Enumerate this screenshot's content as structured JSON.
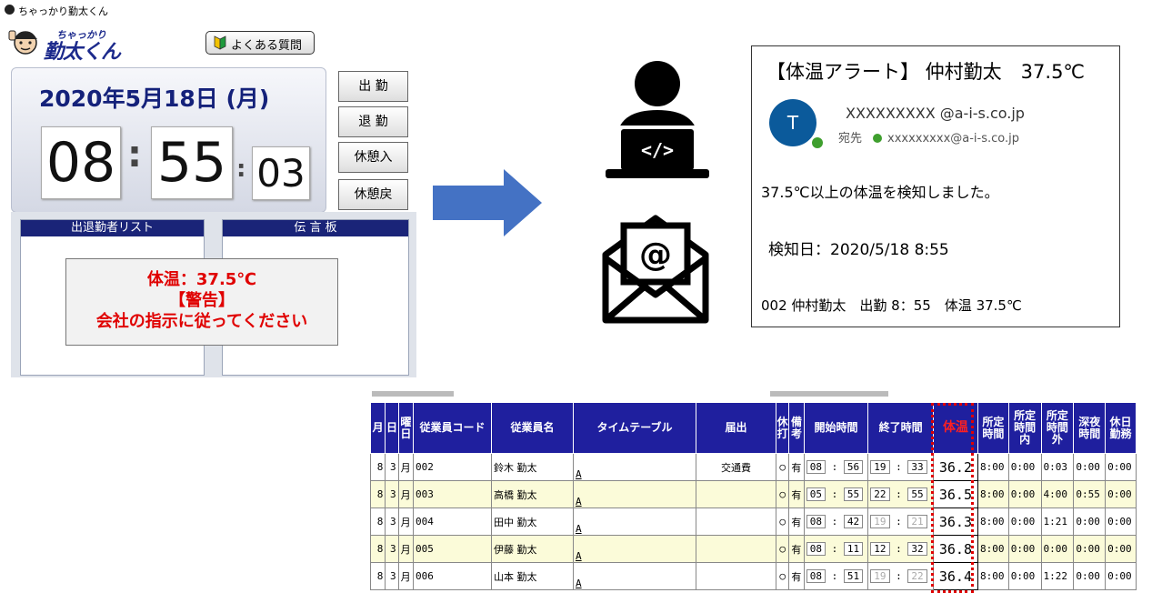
{
  "app": {
    "title": "ちゃっかり勤太くん",
    "brand_sub": "ちゃっかり",
    "brand_main": "勤太くん",
    "faq_label": "よくある質問",
    "date": "2020年5月18日 (月)",
    "time": {
      "hh": "08",
      "mm": "55",
      "ss": "03"
    },
    "buttons": {
      "clock_in": "出 勤",
      "clock_out": "退 勤",
      "break_start": "休憩入",
      "break_end": "休憩戻"
    },
    "panel_list_title": "出退勤者リスト",
    "panel_board_title": "伝 言 板",
    "warning": {
      "line1": "体温：37.5℃",
      "line2": "【警告】",
      "line3": "会社の指示に従ってください"
    }
  },
  "icons": {
    "arrow": "right-arrow-icon",
    "pc": "developer-laptop-icon",
    "mail": "email-at-icon"
  },
  "email": {
    "subject": "【体温アラート】 仲村勤太　37.5℃",
    "avatar_letter": "T",
    "sender": "XXXXXXXXX @a-i-s.co.jp",
    "to_label": "宛先",
    "to_address": "xxxxxxxxx@a-i-s.co.jp",
    "body1": "37.5℃以上の体温を検知しました。",
    "body2": "検知日：2020/5/18 8:55",
    "body3": "002  仲村勤太　出勤 8：55　体温 37.5℃"
  },
  "table": {
    "headers": [
      "月",
      "日",
      "曜日",
      "従業員コード",
      "従業員名",
      "タイムテーブル",
      "届出",
      "休打",
      "備考",
      "開始時間",
      "終了時間",
      "体温",
      "所定時間",
      "所定時間内",
      "所定時間外",
      "深夜時間",
      "休日勤務"
    ],
    "rows": [
      {
        "m": "8",
        "d": "3",
        "w": "月",
        "code": "002",
        "name": "鈴木 勤太",
        "tt": "A",
        "notice": "交通費",
        "kyu": "○",
        "biko": "有",
        "sh": "08",
        "sm": "56",
        "eh": "19",
        "em": "33",
        "temp": "36.2",
        "c1": "8:00",
        "c2": "0:00",
        "c3": "0:03",
        "c4": "0:00",
        "c5": "0:00"
      },
      {
        "m": "8",
        "d": "3",
        "w": "月",
        "code": "003",
        "name": "高橋 勤太",
        "tt": "A",
        "notice": "",
        "kyu": "○",
        "biko": "有",
        "sh": "05",
        "sm": "55",
        "eh": "22",
        "em": "55",
        "temp": "36.5",
        "c1": "8:00",
        "c2": "0:00",
        "c3": "4:00",
        "c4": "0:55",
        "c5": "0:00"
      },
      {
        "m": "8",
        "d": "3",
        "w": "月",
        "code": "004",
        "name": "田中 勤太",
        "tt": "A",
        "notice": "",
        "kyu": "○",
        "biko": "有",
        "sh": "08",
        "sm": "42",
        "eh": "19",
        "em": "21",
        "temp": "36.3",
        "c1": "8:00",
        "c2": "0:00",
        "c3": "1:21",
        "c4": "0:00",
        "c5": "0:00"
      },
      {
        "m": "8",
        "d": "3",
        "w": "月",
        "code": "005",
        "name": "伊藤 勤太",
        "tt": "A",
        "notice": "",
        "kyu": "○",
        "biko": "有",
        "sh": "08",
        "sm": "11",
        "eh": "12",
        "em": "32",
        "temp": "36.8",
        "c1": "8:00",
        "c2": "0:00",
        "c3": "0:00",
        "c4": "0:00",
        "c5": "0:00"
      },
      {
        "m": "8",
        "d": "3",
        "w": "月",
        "code": "006",
        "name": "山本 勤太",
        "tt": "A",
        "notice": "",
        "kyu": "○",
        "biko": "有",
        "sh": "08",
        "sm": "51",
        "eh": "19",
        "em": "22",
        "temp": "36.4",
        "c1": "8:00",
        "c2": "0:00",
        "c3": "1:22",
        "c4": "0:00",
        "c5": "0:00"
      }
    ]
  },
  "colors": {
    "brand_navy": "#1a2478",
    "warning_red": "#e00000",
    "header_blue": "#1f1f9e",
    "highlight_row": "#fbfbd9",
    "avatar_blue": "#0b5a9b",
    "arrow_blue": "#4472c4"
  }
}
